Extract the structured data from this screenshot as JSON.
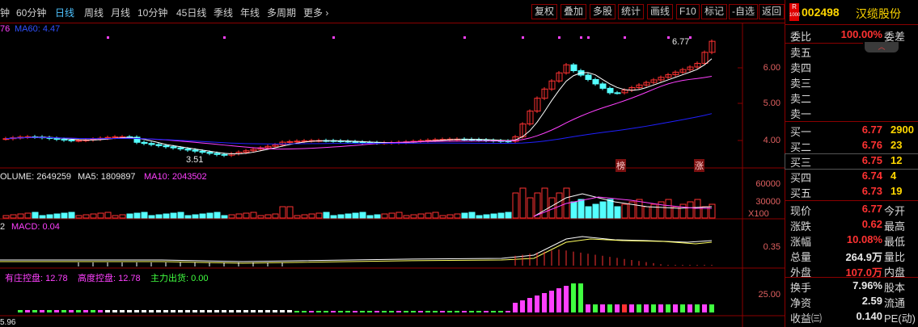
{
  "periods": [
    "钟",
    "60分钟",
    "日线",
    "周线",
    "月线",
    "10分钟",
    "45日线",
    "季线",
    "年线",
    "多周期",
    "更多 ›"
  ],
  "active_period": "日线",
  "tools": [
    "复权",
    "叠加",
    "多股",
    "统计",
    "画线",
    "F10",
    "标记",
    "-自选",
    "返回"
  ],
  "main_chart": {
    "ma_label_prefix": "76",
    "ma60_label": "MA60: 4.47",
    "y_ticks": [
      "6.00",
      "5.00",
      "4.00"
    ],
    "high_mark": "6.77",
    "low_mark": "3.51",
    "tag_bang": "榜",
    "tag_zhang": "涨",
    "colors": {
      "up": "#ff3232",
      "down": "#54ffff",
      "ma1": "#ffffff",
      "ma2": "#ff40ff",
      "ma3": "#2020ff"
    }
  },
  "volume": {
    "label": "OLUME: 2649259",
    "ma5": "MA5: 1809897",
    "ma10": "MA10: 2043502",
    "y_ticks": [
      "60000",
      "30000"
    ],
    "unit": "X100"
  },
  "macd": {
    "prefix": "2",
    "label": "MACD: 0.04",
    "y_tick": "0.35"
  },
  "control": {
    "l1": "有庄控盘: 12.78",
    "l2": "高度控盘: 12.78",
    "l3": "主力出货: 0.00",
    "y_tick": "25.00",
    "bottom": "5.96"
  },
  "quote": {
    "badge_top": "R",
    "badge_bottom": "1000",
    "code": "002498",
    "name": "汉缆股份",
    "weibi_label": "委比",
    "weibi_value": "100.00%",
    "weicha_label": "委差",
    "sells": [
      {
        "label": "卖五",
        "price": "",
        "vol": ""
      },
      {
        "label": "卖四",
        "price": "",
        "vol": ""
      },
      {
        "label": "卖三",
        "price": "",
        "vol": ""
      },
      {
        "label": "卖二",
        "price": "",
        "vol": ""
      },
      {
        "label": "卖一",
        "price": "",
        "vol": ""
      }
    ],
    "buys": [
      {
        "label": "买一",
        "price": "6.77",
        "vol": "2900"
      },
      {
        "label": "买二",
        "price": "6.76",
        "vol": "23"
      },
      {
        "label": "买三",
        "price": "6.75",
        "vol": "12"
      },
      {
        "label": "买四",
        "price": "6.74",
        "vol": "4"
      },
      {
        "label": "买五",
        "price": "6.73",
        "vol": "19"
      }
    ],
    "stats": [
      {
        "label": "现价",
        "value": "6.77",
        "label2": "今开",
        "color": "#ff3232"
      },
      {
        "label": "涨跌",
        "value": "0.62",
        "label2": "最高",
        "color": "#ff3232"
      },
      {
        "label": "涨幅",
        "value": "10.08%",
        "label2": "最低",
        "color": "#ff3232"
      },
      {
        "label": "总量",
        "value": "264.9万",
        "label2": "量比",
        "color": "#e8e8e8"
      },
      {
        "label": "外盘",
        "value": "107.0万",
        "label2": "内盘",
        "color": "#ff3232"
      }
    ],
    "stats2": [
      {
        "label": "换手",
        "value": "7.96%",
        "label2": "股本",
        "color": "#e8e8e8"
      },
      {
        "label": "净资",
        "value": "2.59",
        "label2": "流通",
        "color": "#e8e8e8"
      },
      {
        "label": "收益㈢",
        "value": "0.140",
        "label2": "PE(动)",
        "color": "#e8e8e8"
      }
    ]
  }
}
